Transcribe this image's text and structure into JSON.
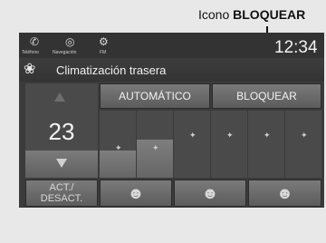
{
  "callout": {
    "prefix": "Icono",
    "emphasis": "BLOQUEAR"
  },
  "statusbar": {
    "phone_label": "Teléfono",
    "nav_label": "Navegación",
    "fm_label": "FM",
    "time": "12:34"
  },
  "header": {
    "title": "Climatización trasera"
  },
  "controls": {
    "auto_label": "AUTOMÁTICO",
    "lock_label": "BLOQUEAR",
    "temperature": "23",
    "onoff_line1": "ACT./",
    "onoff_line2": "DESACT.",
    "fan_levels_total": 6
  },
  "icons": {
    "phone": "phone-icon",
    "navigation": "compass-icon",
    "radio": "radio-icon",
    "fan": "fan-icon",
    "temp_up": "triangle-up-icon",
    "temp_down": "triangle-down-icon",
    "airflow": [
      "airflow-face-icon",
      "airflow-face-feet-icon",
      "airflow-feet-icon"
    ]
  }
}
